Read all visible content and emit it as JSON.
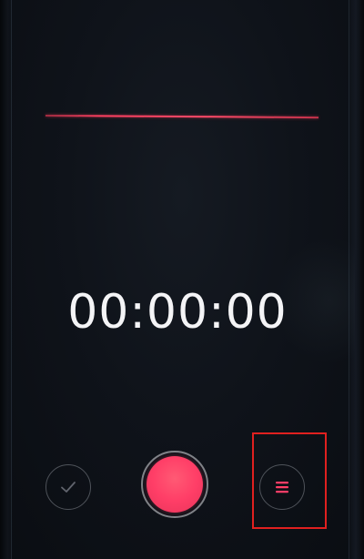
{
  "recorder": {
    "timer": "00:00:00",
    "icons": {
      "done": "checkmark-icon",
      "record": "record-icon",
      "list": "list-icon"
    },
    "colors": {
      "accent": "#ff3e67",
      "waveform": "#ff3f60",
      "highlight": "#e0201f",
      "timer_text": "#f4f4f6"
    }
  }
}
